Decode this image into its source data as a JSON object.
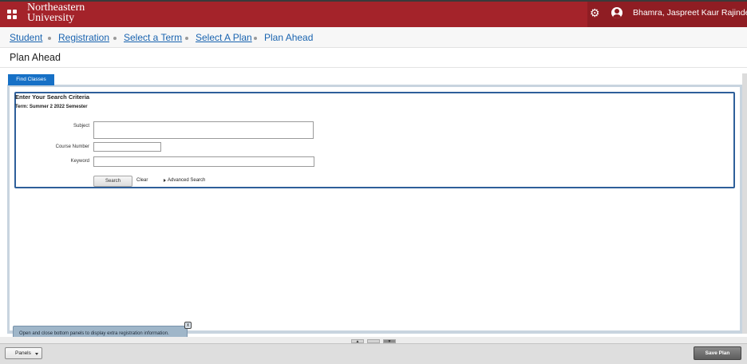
{
  "header": {
    "logo_line1": "Northeastern",
    "logo_line2": "University",
    "user_name": "Bhamra, Jaspreet Kaur Rajinder Si",
    "brand_color": "#a4232a",
    "menu_icon": "grid-menu-icon",
    "settings_icon": "gear-icon",
    "user_icon": "user-avatar-icon"
  },
  "breadcrumb": {
    "items": [
      "Student",
      "Registration",
      "Select a Term",
      "Select A Plan",
      "Plan Ahead"
    ]
  },
  "page": {
    "title": "Plan Ahead"
  },
  "tabs": {
    "find_classes": "Find Classes"
  },
  "search": {
    "heading": "Enter Your Search Criteria",
    "term": "Term: Summer 2 2022 Semester",
    "subject_label": "Subject",
    "subject_value": "",
    "course_number_label": "Course Number",
    "course_number_value": "",
    "keyword_label": "Keyword",
    "keyword_value": "",
    "search_button": "Search",
    "clear_link": "Clear",
    "advanced_link": "Advanced Search"
  },
  "tooltip": {
    "text": "Open and close bottom panels to display extra registration information.",
    "close": "x"
  },
  "footer": {
    "panels_button": "Panels",
    "save_button": "Save Plan"
  }
}
